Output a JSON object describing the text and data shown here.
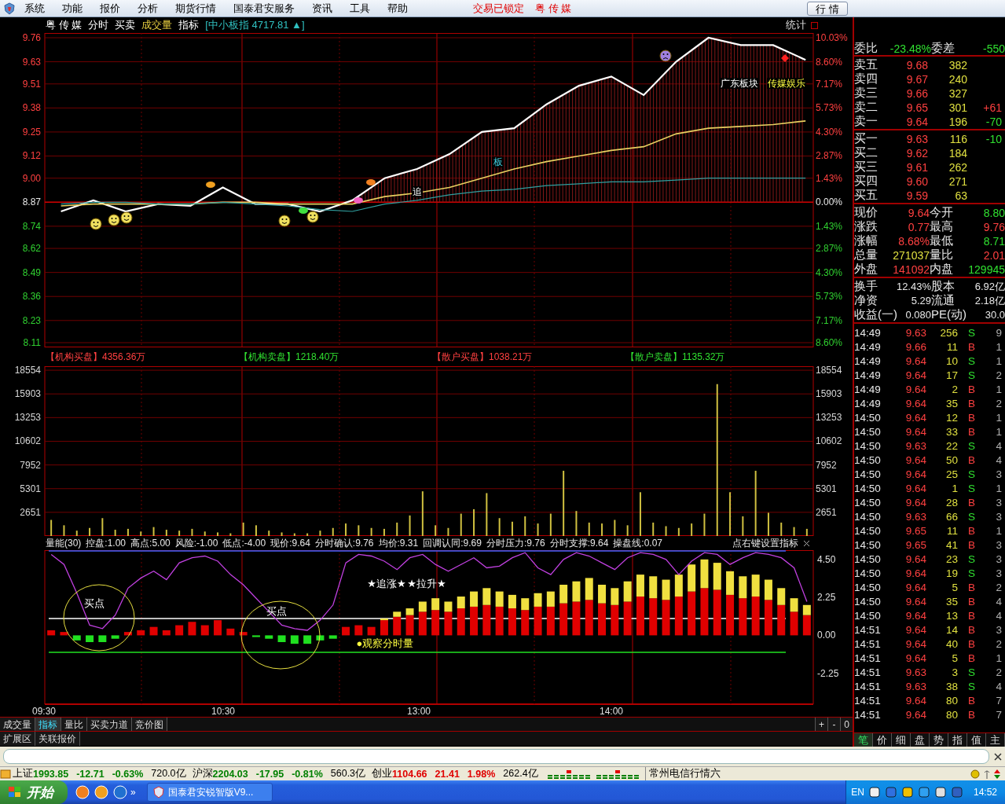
{
  "menu_bar": {
    "items": [
      "系统",
      "功能",
      "报价",
      "分析",
      "期货行情",
      "国泰君安服务",
      "资讯",
      "工具",
      "帮助"
    ],
    "lock_status": "交易已锁定",
    "stock_name": "粤 传 媒",
    "quote_button": "行 情"
  },
  "main": {
    "header": {
      "stock": "粤 传 媒",
      "views": [
        {
          "label": "分时",
          "kind": "view"
        },
        {
          "label": "买卖",
          "kind": "view"
        },
        {
          "label": "成交量",
          "kind": "highlight"
        },
        {
          "label": "指标",
          "kind": "view"
        }
      ],
      "index_quote": "[中小板指 4717.81 ▲]",
      "stats_button": "统计"
    },
    "price_chart": {
      "percent_ticks": [
        "10.03%",
        "8.60%",
        "7.17%",
        "5.73%",
        "4.30%",
        "2.87%",
        "1.43%",
        "0.00%",
        "1.43%",
        "2.87%",
        "4.30%",
        "5.73%",
        "7.17%",
        "8.60%"
      ],
      "chart_data": {
        "type": "line",
        "grid": true,
        "categories": [
          null,
          null,
          null,
          null,
          null,
          null,
          null,
          null,
          null,
          null,
          null,
          null,
          null,
          null,
          null,
          null,
          null,
          null,
          null,
          null,
          null,
          null,
          null,
          null
        ],
        "ylim": [
          8.11,
          9.76
        ],
        "ref_lines": [
          {
            "axis": "y",
            "value": 8.87
          }
        ],
        "yticks": [
          {
            "value": 9.76,
            "label": "9.76"
          },
          {
            "value": 9.63,
            "label": "9.63"
          },
          {
            "value": 9.51,
            "label": "9.51"
          },
          {
            "value": 9.38,
            "label": "9.38"
          },
          {
            "value": 9.25,
            "label": "9.25"
          },
          {
            "value": 9.12,
            "label": "9.12"
          },
          {
            "value": 9.0,
            "label": "9.00"
          },
          {
            "value": 8.87,
            "label": "8.87"
          },
          {
            "value": 8.74,
            "label": "8.74"
          },
          {
            "value": 8.62,
            "label": "8.62"
          },
          {
            "value": 8.49,
            "label": "8.49"
          },
          {
            "value": 8.36,
            "label": "8.36"
          },
          {
            "value": 8.23,
            "label": "8.23"
          },
          {
            "value": 8.11,
            "label": "8.11"
          }
        ],
        "series": [
          {
            "color": "#ffffff",
            "values": [
              8.82,
              8.88,
              8.82,
              8.86,
              8.85,
              8.95,
              8.86,
              8.86,
              8.82,
              8.88,
              9.0,
              9.05,
              9.13,
              9.25,
              9.27,
              9.4,
              9.5,
              9.55,
              9.45,
              9.63,
              9.76,
              9.72,
              9.72,
              9.64
            ]
          },
          {
            "color": "#e8d060",
            "values": [
              8.85,
              8.86,
              8.86,
              8.86,
              8.86,
              8.87,
              8.87,
              8.86,
              8.86,
              8.86,
              8.9,
              8.92,
              8.95,
              9.0,
              9.05,
              9.09,
              9.12,
              9.15,
              9.17,
              9.24,
              9.27,
              9.28,
              9.29,
              9.31
            ]
          },
          {
            "color": "#30a0a0",
            "values": [
              8.86,
              8.87,
              8.87,
              8.86,
              8.86,
              8.87,
              8.86,
              8.85,
              8.83,
              8.82,
              8.86,
              8.88,
              8.91,
              8.93,
              8.94,
              8.96,
              8.97,
              8.98,
              8.98,
              8.99,
              9.0,
              9.0,
              9.0,
              9.0
            ]
          }
        ],
        "annotations": [
          "追",
          "板",
          "广东板块",
          "传媒娱乐"
        ]
      }
    },
    "flow_stats": [
      {
        "label": "【机构买盘】",
        "value": "4356.36万",
        "color": "#ff4040"
      },
      {
        "label": "【机构卖盘】",
        "value": "1218.40万",
        "color": "#30e030"
      },
      {
        "label": "【散户买盘】",
        "value": "1038.21万",
        "color": "#ff4040"
      },
      {
        "label": "【散户卖盘】",
        "value": "1135.32万",
        "color": "#30e030"
      }
    ],
    "volume_chart": {
      "left_ticks": [
        "18554",
        "15903",
        "13253",
        "10602",
        "7952",
        "5301",
        "2651"
      ],
      "right_ticks": [
        "18554",
        "15903",
        "13253",
        "10602",
        "7952",
        "5301",
        "2651"
      ],
      "chart_data": {
        "type": "bar",
        "grid": true,
        "categories": [
          null,
          null,
          null,
          null,
          null,
          null,
          null,
          null,
          null,
          null,
          null,
          null,
          null,
          null,
          null,
          null,
          null,
          null,
          null,
          null,
          null,
          null,
          null,
          null,
          null,
          null,
          null,
          null,
          null,
          null,
          null,
          null,
          null,
          null,
          null,
          null,
          null,
          null,
          null,
          null,
          null,
          null,
          null,
          null,
          null,
          null,
          null,
          null,
          null,
          null,
          null,
          null,
          null,
          null,
          null,
          null,
          null,
          null,
          null,
          null
        ],
        "ylim": [
          0,
          19000
        ],
        "yticks": [
          18554,
          15903,
          13253,
          10602,
          7952,
          5301,
          2651
        ],
        "series": [
          {
            "color": "#d0c040",
            "values": [
              1800,
              1200,
              600,
              900,
              2000,
              700,
              800,
              500,
              1000,
              700,
              600,
              800,
              500,
              400,
              300,
              1500,
              1200,
              600,
              400,
              300,
              300,
              600,
              900,
              1400,
              1200,
              900,
              800,
              1500,
              2300,
              5000,
              1200,
              900,
              2500,
              3000,
              4800,
              2000,
              1600,
              2200,
              1400,
              2500,
              7300,
              2800,
              1500,
              1400,
              1800,
              1200,
              4900,
              1500,
              1100,
              900,
              1400,
              2500,
              17000,
              4900,
              2200,
              7300,
              2600,
              1500,
              1000,
              800
            ]
          }
        ]
      }
    },
    "indicator_header": {
      "items": [
        "量能(30)",
        "控盘:1.00",
        "高点:5.00",
        "风险:-1.00",
        "低点:-4.00",
        "现价:9.64",
        "分时确认:9.76",
        "均价:9.31",
        "回调认同:9.69",
        "分时压力:9.76",
        "分时支撑:9.64",
        "操盘线:0.07"
      ],
      "hint": "点右键设置指标"
    },
    "indicator_chart": {
      "chart_data": {
        "type": "bar",
        "stacked": true,
        "grid": "x",
        "ref_lines": [
          {
            "axis": "y",
            "value": 5.0
          },
          {
            "axis": "y",
            "value": 1.0
          },
          {
            "axis": "y",
            "value": -1.0
          }
        ],
        "categories": [
          null,
          null,
          null,
          null,
          null,
          null,
          null,
          null,
          null,
          null,
          null,
          null,
          null,
          null,
          null,
          null,
          null,
          null,
          null,
          null,
          null,
          null,
          null,
          null,
          null,
          null,
          null,
          null,
          null,
          null,
          null,
          null,
          null,
          null,
          null,
          null,
          null,
          null,
          null,
          null,
          null,
          null,
          null,
          null,
          null,
          null,
          null,
          null,
          null,
          null,
          null,
          null,
          null,
          null,
          null,
          null,
          null,
          null,
          null,
          null
        ],
        "ylim": [
          -4.08,
          5.05
        ],
        "yticks": [
          {
            "value": 4.5,
            "label": "4.50"
          },
          {
            "value": 2.25,
            "label": "2.25"
          },
          {
            "value": 0,
            "label": "0.00"
          },
          {
            "value": -2.25,
            "label": "-2.25"
          }
        ],
        "series": [
          {
            "color": "#e00000",
            "values": [
              0.3,
              0.2,
              null,
              null,
              null,
              null,
              0.2,
              0.3,
              0.5,
              0.3,
              0.6,
              0.8,
              0.6,
              0.9,
              0.4,
              0.2,
              null,
              null,
              null,
              null,
              null,
              null,
              null,
              0.5,
              0.6,
              0.5,
              0.9,
              1.1,
              1.2,
              1.4,
              1.5,
              1.4,
              1.6,
              1.7,
              1.8,
              1.7,
              1.6,
              1.5,
              1.7,
              1.7,
              1.9,
              2.0,
              2.1,
              1.9,
              1.8,
              2.0,
              2.3,
              2.2,
              2.1,
              2.3,
              2.6,
              2.8,
              2.7,
              2.4,
              2.2,
              2.3,
              2.1,
              1.8,
              1.4,
              1.2
            ]
          },
          {
            "color": "#f0e040",
            "values": [
              null,
              null,
              null,
              null,
              null,
              null,
              null,
              null,
              null,
              null,
              null,
              null,
              null,
              null,
              null,
              null,
              null,
              null,
              null,
              null,
              null,
              null,
              null,
              null,
              null,
              null,
              0.1,
              0.3,
              0.4,
              0.6,
              0.7,
              0.6,
              0.7,
              0.9,
              1.0,
              0.9,
              0.8,
              0.7,
              0.8,
              0.9,
              1.1,
              1.2,
              1.3,
              1.1,
              1.0,
              1.2,
              1.3,
              1.3,
              1.2,
              1.3,
              1.6,
              1.7,
              1.6,
              1.4,
              1.3,
              1.3,
              1.2,
              1.0,
              0.8,
              0.6
            ]
          },
          {
            "type": "line",
            "color": "#c040e0",
            "values": [
              4.8,
              4.2,
              2.5,
              0.6,
              0.4,
              1.2,
              2.8,
              3.4,
              3.8,
              3.3,
              4.3,
              4.6,
              4.7,
              4.4,
              3.6,
              3.0,
              2.2,
              1.4,
              0.6,
              0.4,
              0.3,
              0.9,
              1.8,
              4.3,
              4.8,
              4.7,
              4.4,
              3.9,
              4.6,
              4.8,
              4.2,
              3.8,
              4.2,
              4.6,
              4.0,
              4.1,
              4.6,
              4.9,
              4.0,
              3.6,
              4.5,
              4.9,
              4.7,
              4.3,
              3.9,
              4.6,
              4.9,
              4.8,
              4.5,
              3.6,
              4.4,
              4.9,
              4.8,
              4.2,
              4.6,
              4.9,
              4.8,
              4.6,
              4.0,
              2.0
            ]
          },
          {
            "color": "#20e020",
            "values": [
              null,
              null,
              -0.3,
              -0.4,
              -0.4,
              -0.2,
              null,
              null,
              null,
              null,
              null,
              null,
              null,
              null,
              null,
              null,
              -0.1,
              -0.2,
              -0.4,
              -0.5,
              -0.5,
              -0.3,
              -0.2,
              null,
              null,
              null,
              null,
              null,
              null,
              null,
              null,
              null,
              null,
              null,
              null,
              null,
              null,
              null,
              null,
              null,
              null,
              null,
              null,
              null,
              null,
              null,
              null,
              null,
              null,
              null,
              null,
              null,
              null,
              null,
              null,
              null,
              null,
              null,
              null,
              null
            ]
          }
        ],
        "annotations": [
          "买点",
          "买点",
          "★追涨★",
          "★拉升★",
          "●观察分时量"
        ]
      }
    },
    "time_axis": [
      "09:30",
      "10:30",
      "13:00",
      "14:00"
    ],
    "bottom_tabs": [
      {
        "label": "成交量",
        "selected": false
      },
      {
        "label": "指标",
        "selected": true
      },
      {
        "label": "量比",
        "selected": false
      },
      {
        "label": "买卖力道",
        "selected": false
      },
      {
        "label": "竞价图",
        "selected": false
      }
    ],
    "zoom_buttons": [
      "+",
      "-",
      "0"
    ],
    "extra_tabs": [
      "扩展区",
      "关联报价"
    ]
  },
  "quote_panel": {
    "ratio": [
      {
        "label": "委比",
        "value": "-23.48%",
        "color": "#30e030"
      },
      {
        "label": "委差",
        "value": "-550",
        "color": "#30e030"
      }
    ],
    "asks": [
      {
        "label": "卖五",
        "price": "9.68",
        "volume": "382"
      },
      {
        "label": "卖四",
        "price": "9.67",
        "volume": "240"
      },
      {
        "label": "卖三",
        "price": "9.66",
        "volume": "327"
      },
      {
        "label": "卖二",
        "price": "9.65",
        "volume": "301",
        "change": "+61",
        "color": "#ff4040"
      },
      {
        "label": "卖一",
        "price": "9.64",
        "volume": "196",
        "change": "-70",
        "color": "#30e030"
      }
    ],
    "bids": [
      {
        "label": "买一",
        "price": "9.63",
        "volume": "116",
        "change": "-10",
        "color": "#30e030"
      },
      {
        "label": "买二",
        "price": "9.62",
        "volume": "184"
      },
      {
        "label": "买三",
        "price": "9.61",
        "volume": "262"
      },
      {
        "label": "买四",
        "price": "9.60",
        "volume": "271"
      },
      {
        "label": "买五",
        "price": "9.59",
        "volume": "63"
      }
    ],
    "stats": [
      {
        "label": "现价",
        "value": "9.64",
        "color": "#ff4040"
      },
      {
        "label": "今开",
        "value": "8.80",
        "color": "#30e030"
      },
      {
        "label": "涨跌",
        "value": "0.77",
        "color": "#ff4040"
      },
      {
        "label": "最高",
        "value": "9.76",
        "color": "#ff4040"
      },
      {
        "label": "涨幅",
        "value": "8.68%",
        "color": "#ff4040"
      },
      {
        "label": "最低",
        "value": "8.71",
        "color": "#30e030"
      },
      {
        "label": "总量",
        "value": "271037",
        "color": "#e0e040"
      },
      {
        "label": "量比",
        "value": "2.01",
        "color": "#ff4040"
      },
      {
        "label": "外盘",
        "value": "141092",
        "color": "#ff4040"
      },
      {
        "label": "内盘",
        "value": "129945",
        "color": "#30e030"
      }
    ],
    "fundamentals": [
      {
        "label": "换手",
        "value": "12.43%"
      },
      {
        "label": "股本",
        "value": "6.92亿"
      },
      {
        "label": "净资",
        "value": "5.29"
      },
      {
        "label": "流通",
        "value": "2.18亿"
      },
      {
        "label": "收益(一)",
        "value": "0.080"
      },
      {
        "label": "PE(动)",
        "value": "30.0"
      }
    ],
    "trades": [
      {
        "time": "14:49",
        "price": "9.63",
        "volume": "256",
        "side": "S",
        "kind": "sell",
        "count": "9"
      },
      {
        "time": "14:49",
        "price": "9.66",
        "volume": "11",
        "side": "B",
        "kind": "buy",
        "count": "1"
      },
      {
        "time": "14:49",
        "price": "9.64",
        "volume": "10",
        "side": "S",
        "kind": "sell",
        "count": "1"
      },
      {
        "time": "14:49",
        "price": "9.64",
        "volume": "17",
        "side": "S",
        "kind": "sell",
        "count": "2"
      },
      {
        "time": "14:49",
        "price": "9.64",
        "volume": "2",
        "side": "B",
        "kind": "buy",
        "count": "1"
      },
      {
        "time": "14:49",
        "price": "9.64",
        "volume": "35",
        "side": "B",
        "kind": "buy",
        "count": "2"
      },
      {
        "time": "14:50",
        "price": "9.64",
        "volume": "12",
        "side": "B",
        "kind": "buy",
        "count": "1"
      },
      {
        "time": "14:50",
        "price": "9.64",
        "volume": "33",
        "side": "B",
        "kind": "buy",
        "count": "1"
      },
      {
        "time": "14:50",
        "price": "9.63",
        "volume": "22",
        "side": "S",
        "kind": "sell",
        "count": "4"
      },
      {
        "time": "14:50",
        "price": "9.64",
        "volume": "50",
        "side": "B",
        "kind": "buy",
        "count": "4"
      },
      {
        "time": "14:50",
        "price": "9.64",
        "volume": "25",
        "side": "S",
        "kind": "sell",
        "count": "3"
      },
      {
        "time": "14:50",
        "price": "9.64",
        "volume": "1",
        "side": "S",
        "kind": "sell",
        "count": "1"
      },
      {
        "time": "14:50",
        "price": "9.64",
        "volume": "28",
        "side": "B",
        "kind": "buy",
        "count": "3"
      },
      {
        "time": "14:50",
        "price": "9.63",
        "volume": "66",
        "side": "S",
        "kind": "sell",
        "count": "3"
      },
      {
        "time": "14:50",
        "price": "9.65",
        "volume": "11",
        "side": "B",
        "kind": "buy",
        "count": "1"
      },
      {
        "time": "14:50",
        "price": "9.65",
        "volume": "41",
        "side": "B",
        "kind": "buy",
        "count": "3"
      },
      {
        "time": "14:50",
        "price": "9.64",
        "volume": "23",
        "side": "S",
        "kind": "sell",
        "count": "3"
      },
      {
        "time": "14:50",
        "price": "9.64",
        "volume": "19",
        "side": "S",
        "kind": "sell",
        "count": "3"
      },
      {
        "time": "14:50",
        "price": "9.64",
        "volume": "5",
        "side": "B",
        "kind": "buy",
        "count": "2"
      },
      {
        "time": "14:50",
        "price": "9.64",
        "volume": "35",
        "side": "B",
        "kind": "buy",
        "count": "4"
      },
      {
        "time": "14:50",
        "price": "9.64",
        "volume": "13",
        "side": "B",
        "kind": "buy",
        "count": "4"
      },
      {
        "time": "14:51",
        "price": "9.64",
        "volume": "14",
        "side": "B",
        "kind": "buy",
        "count": "3"
      },
      {
        "time": "14:51",
        "price": "9.64",
        "volume": "40",
        "side": "B",
        "kind": "buy",
        "count": "2"
      },
      {
        "time": "14:51",
        "price": "9.64",
        "volume": "5",
        "side": "B",
        "kind": "buy",
        "count": "1"
      },
      {
        "time": "14:51",
        "price": "9.63",
        "volume": "3",
        "side": "S",
        "kind": "sell",
        "count": "2"
      },
      {
        "time": "14:51",
        "price": "9.63",
        "volume": "38",
        "side": "S",
        "kind": "sell",
        "count": "4"
      },
      {
        "time": "14:51",
        "price": "9.64",
        "volume": "80",
        "side": "B",
        "kind": "buy",
        "count": "7"
      },
      {
        "time": "14:51",
        "price": "9.64",
        "volume": "80",
        "side": "B",
        "kind": "buy",
        "count": "7"
      }
    ],
    "tabs": [
      {
        "label": "笔",
        "selected": true
      },
      {
        "label": "价",
        "selected": false
      },
      {
        "label": "细",
        "selected": false
      },
      {
        "label": "盘",
        "selected": false
      },
      {
        "label": "势",
        "selected": false
      },
      {
        "label": "指",
        "selected": false
      },
      {
        "label": "值",
        "selected": false
      },
      {
        "label": "主",
        "selected": false
      }
    ]
  },
  "ticker_bar": {
    "indices": [
      {
        "name": "上证",
        "value": "1993.85",
        "change": "-12.71",
        "percent": "-0.63%",
        "amount": "720.0亿",
        "color": "#008000"
      },
      {
        "name": "沪深",
        "value": "2204.03",
        "change": "-17.95",
        "percent": "-0.81%",
        "amount": "560.3亿",
        "color": "#008000"
      },
      {
        "name": "创业",
        "value": "1104.66",
        "change": "21.41",
        "percent": "1.98%",
        "amount": "262.4亿",
        "color": "#e00000"
      }
    ],
    "source": "常州电信行情六"
  },
  "taskbar": {
    "start": "开始",
    "more": "»",
    "task": "国泰君安锐智版V9...",
    "language": "EN",
    "clock": "14:52"
  }
}
